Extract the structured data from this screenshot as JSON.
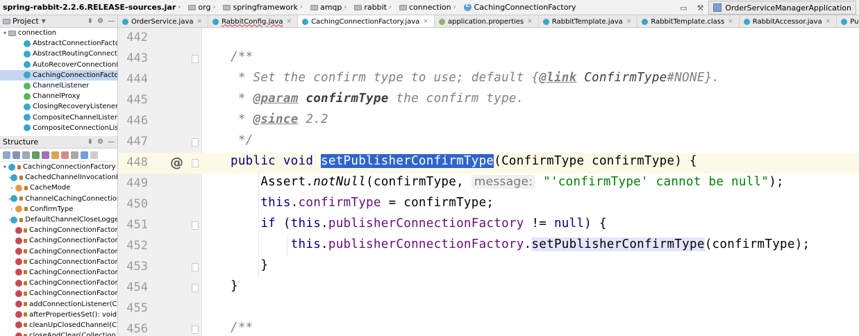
{
  "navbar": {
    "jar": "spring-rabbit-2.2.6.RELEASE-sources.jar",
    "crumbs": [
      "org",
      "springframework",
      "amqp",
      "rabbit",
      "connection"
    ],
    "current_class": "CachingConnectionFactory",
    "run_config": "OrderServiceManagerApplication"
  },
  "project": {
    "title": "Project",
    "root": "connection",
    "items": [
      "AbstractConnectionFactory",
      "AbstractRoutingConnectionFa",
      "AutoRecoverConnectionNotC",
      "CachingConnectionFactory",
      "ChannelListener",
      "ChannelProxy",
      "ClosingRecoveryListener",
      "CompositeChannelListener",
      "CompositeConnectionListene"
    ]
  },
  "structure": {
    "title": "Structure",
    "root": "CachingConnectionFactory",
    "items": [
      {
        "label": "CachedChannelInvocationH",
        "kind": "c"
      },
      {
        "label": "CacheMode",
        "kind": "e"
      },
      {
        "label": "ChannelCachingConnection",
        "kind": "c"
      },
      {
        "label": "ConfirmType",
        "kind": "e"
      },
      {
        "label": "DefaultChannelCloseLogge",
        "kind": "c"
      },
      {
        "label": "CachingConnectionFactory(",
        "kind": "m"
      },
      {
        "label": "CachingConnectionFactory(",
        "kind": "m"
      },
      {
        "label": "CachingConnectionFactory(",
        "kind": "m"
      },
      {
        "label": "CachingConnectionFactory(",
        "kind": "m"
      },
      {
        "label": "CachingConnectionFactory(",
        "kind": "m"
      },
      {
        "label": "CachingConnectionFactory(",
        "kind": "m"
      },
      {
        "label": "CachingConnectionFactory(",
        "kind": "m"
      },
      {
        "label": "addConnectionListener(Co",
        "kind": "m"
      },
      {
        "label": "afterPropertiesSet(): void",
        "kind": "m"
      },
      {
        "label": "cleanUpClosedChannel(Cha",
        "kind": "m"
      },
      {
        "label": "closeAndClear(Collection",
        "kind": "m"
      }
    ]
  },
  "tabs": [
    {
      "label": "OrderService.java",
      "color": "#3aa6c9",
      "active": false,
      "err": false
    },
    {
      "label": "RabbitConfig.java",
      "color": "#3aa6c9",
      "active": false,
      "err": true
    },
    {
      "label": "CachingConnectionFactory.java",
      "color": "#3aa6c9",
      "active": true,
      "err": false
    },
    {
      "label": "application.properties",
      "color": "#8fb36b",
      "active": false,
      "err": false
    },
    {
      "label": "RabbitTemplate.java",
      "color": "#3aa6c9",
      "active": false,
      "err": false
    },
    {
      "label": "RabbitTemplate.class",
      "color": "#3aa6c9",
      "active": false,
      "err": false
    },
    {
      "label": "RabbitAccessor.java",
      "color": "#3aa6c9",
      "active": false,
      "err": false
    },
    {
      "label": "PublisherCallbackChannelImpl.java",
      "color": "#3aa6c9",
      "active": false,
      "err": false
    }
  ],
  "editor": {
    "line_numbers": [
      "442",
      "443",
      "444",
      "445",
      "446",
      "447",
      "448",
      "449",
      "450",
      "451",
      "452",
      "453",
      "454",
      "455",
      "456"
    ],
    "current_line": "448",
    "tokens": {
      "l443": "/**",
      "l444a": " * Set the confirm type to use; default {",
      "l444b": "@link",
      "l444c": " ConfirmType",
      "l444d": "#NONE",
      "l444e": "}.",
      "l445a": " * ",
      "l445b": "@param",
      "l445c": " confirmType",
      "l445d": " the confirm type.",
      "l446a": " * ",
      "l446b": "@since",
      "l446c": " 2.2",
      "l447": " */",
      "l448a": "public void ",
      "l448b": "setPublisherConfirmType",
      "l448c": "(ConfirmType confirmType) {",
      "l449a": "    Assert.",
      "l449b": "notNull",
      "l449c": "(confirmType, ",
      "l449hint": "message:",
      "l449d": " \"'confirmType' cannot be null\"",
      "l449e": ");",
      "l450a": "    ",
      "l450b": "this",
      "l450c": ".",
      "l450d": "confirmType",
      "l450e": " = confirmType;",
      "l451a": "    ",
      "l451b": "if",
      "l451c": " (",
      "l451d": "this",
      "l451e": ".",
      "l451f": "publisherConnectionFactory",
      "l451g": " != ",
      "l451h": "null",
      "l451i": ") {",
      "l452a": "        ",
      "l452b": "this",
      "l452c": ".",
      "l452d": "publisherConnectionFactory",
      "l452e": ".",
      "l452f": "setPublisherConfirmType",
      "l452g": "(confirmType);",
      "l453": "    }",
      "l454": "}",
      "l456": "/**"
    }
  }
}
